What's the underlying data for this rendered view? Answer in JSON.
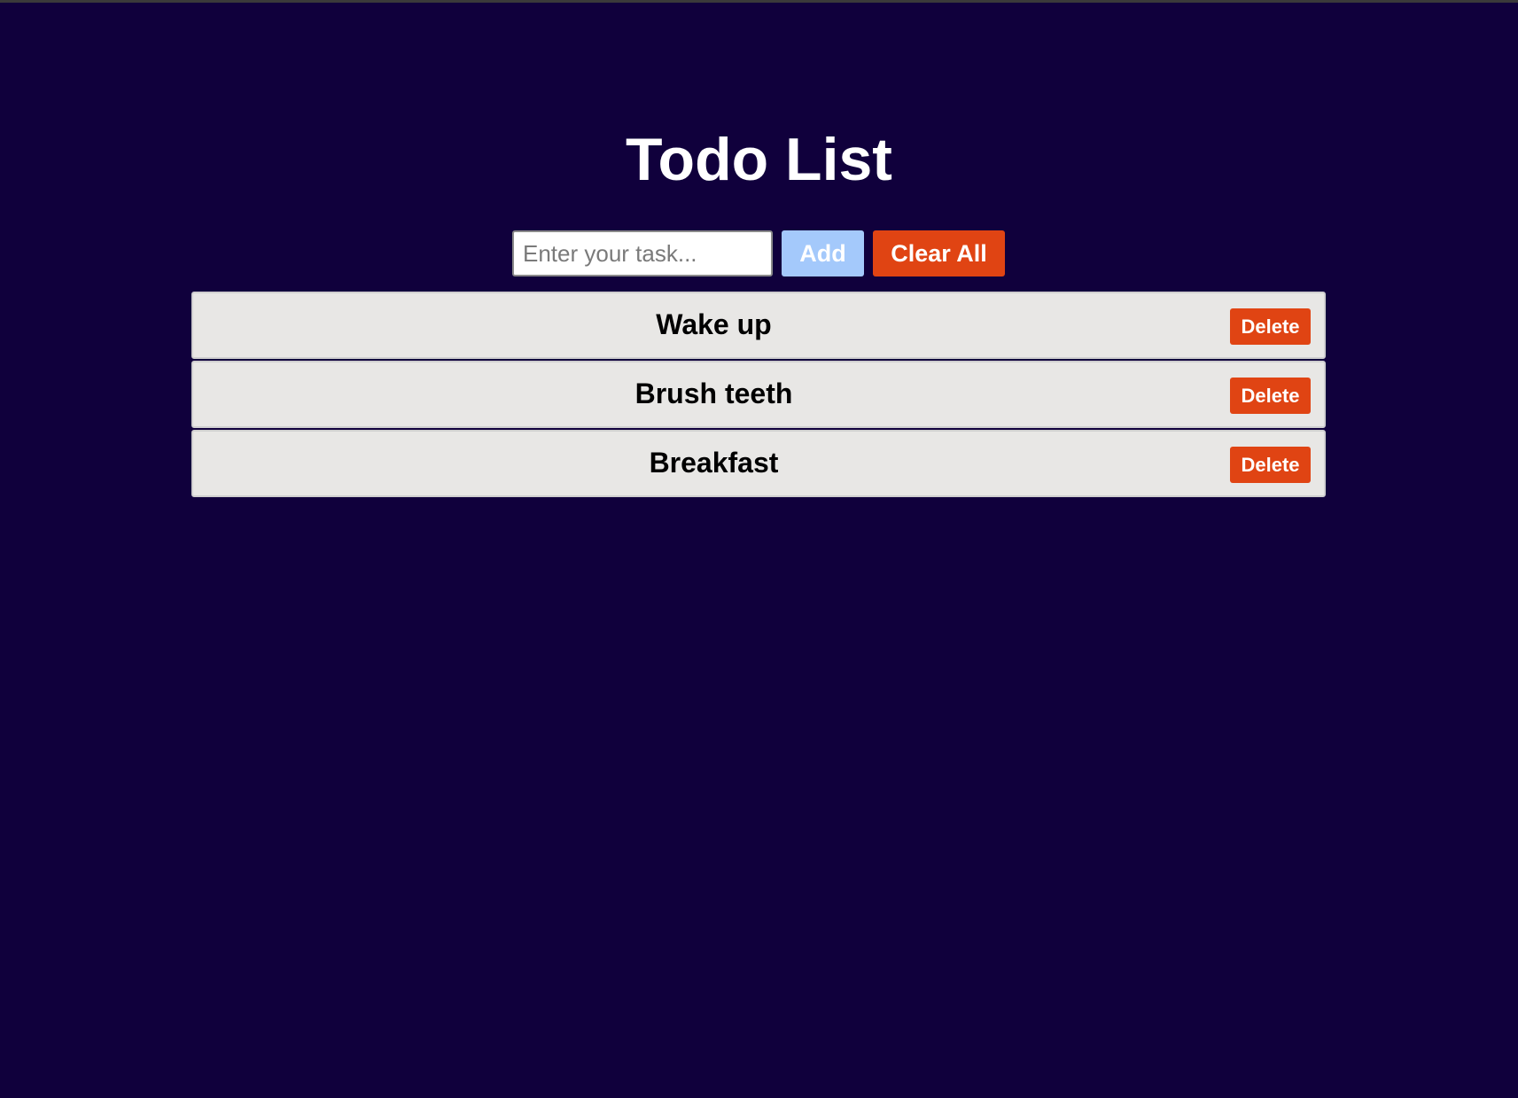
{
  "app": {
    "title": "Todo List"
  },
  "form": {
    "input_value": "",
    "input_placeholder": "Enter your task...",
    "add_label": "Add",
    "clear_label": "Clear All"
  },
  "todos": [
    {
      "text": "Wake up",
      "delete_label": "Delete"
    },
    {
      "text": "Brush teeth",
      "delete_label": "Delete"
    },
    {
      "text": "Breakfast",
      "delete_label": "Delete"
    }
  ],
  "colors": {
    "background": "#10003c",
    "add_button": "#a4c9fb",
    "danger_button": "#e04413",
    "item_background": "#e8e7e5"
  }
}
